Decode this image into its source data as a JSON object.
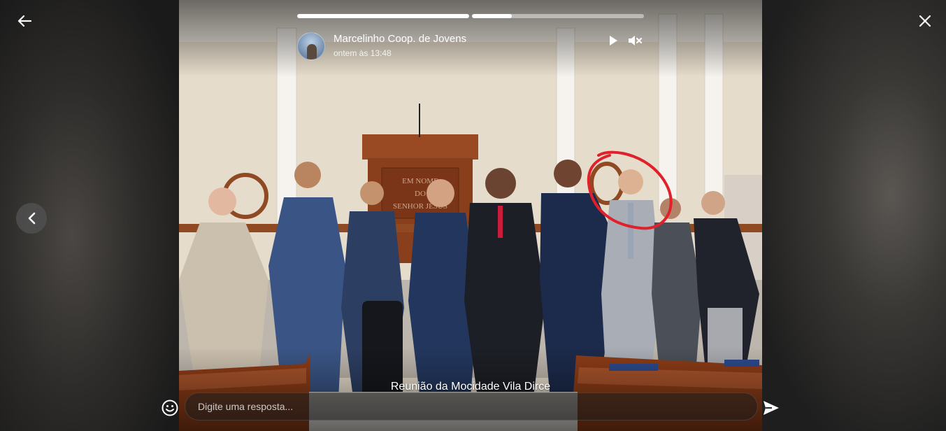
{
  "viewer": {
    "back_icon": "arrow-left-icon",
    "close_icon": "close-icon",
    "prev_icon": "chevron-left-icon"
  },
  "story": {
    "segments": [
      {
        "progress": 1.0
      },
      {
        "progress": 0.23
      }
    ],
    "author": "Marcelinho Coop. de Jovens",
    "timestamp": "ontem às 13:48",
    "play_icon": "play-icon",
    "mute_icon": "volume-muted-icon",
    "caption": "Reunião da Mocidade Vila Dirce",
    "photo_text": {
      "pulpit_line1": "EM NOME",
      "pulpit_line2": "DO",
      "pulpit_line3": "SENHOR JESUS"
    },
    "highlight_color": "#e0202a"
  },
  "reply": {
    "placeholder": "Digite uma resposta...",
    "emoji_icon": "emoji-icon",
    "send_icon": "send-icon"
  }
}
